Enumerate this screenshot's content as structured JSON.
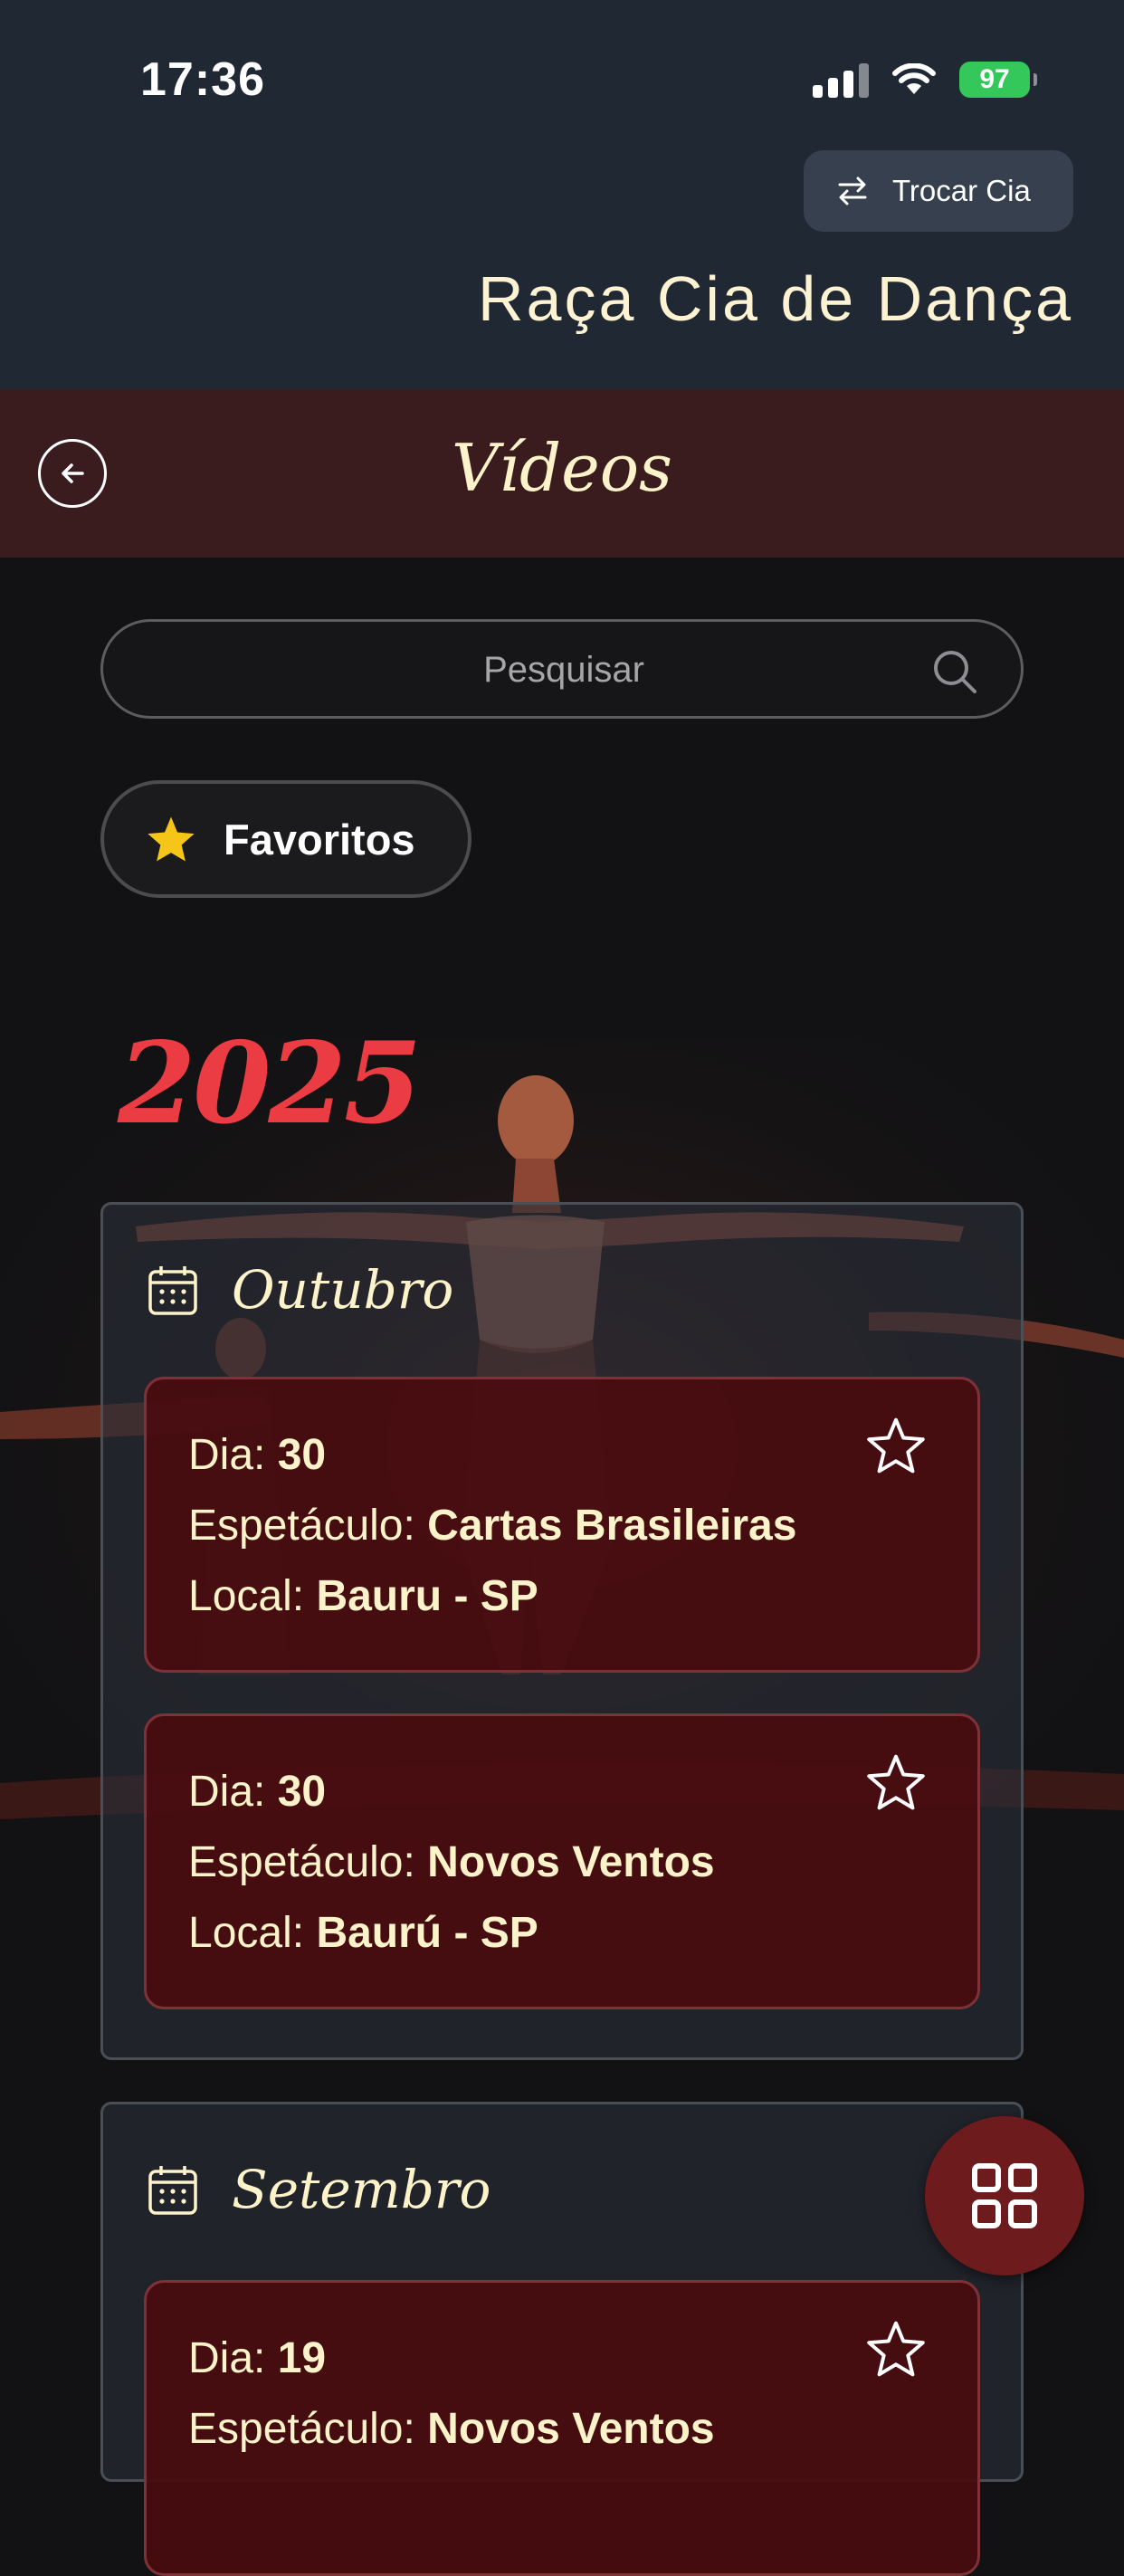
{
  "status_bar": {
    "time": "17:36",
    "battery": "97"
  },
  "header": {
    "switch_label": "Trocar Cia",
    "company_name": "Raça Cia de Dança",
    "title": "Vídeos"
  },
  "search": {
    "placeholder": "Pesquisar"
  },
  "favorites_label": "Favoritos",
  "year": "2025",
  "labels": {
    "day": "Dia:",
    "show": "Espetáculo:",
    "place": "Local:"
  },
  "months": [
    {
      "name": "Outubro",
      "events": [
        {
          "day": "30",
          "show": "Cartas Brasileiras",
          "place": "Bauru - SP"
        },
        {
          "day": "30",
          "show": "Novos Ventos",
          "place": "Baurú - SP"
        }
      ]
    },
    {
      "name": "Setembro",
      "events": [
        {
          "day": "19",
          "show": "Novos Ventos",
          "place": ""
        }
      ]
    }
  ],
  "colors": {
    "header_bg": "#202834",
    "title_bar_bg": "#3a1c1f",
    "accent_cream": "#fdf3cb",
    "year_red": "#ec3c43",
    "card_bg": "#490c0f",
    "fab_bg": "#6e1b1e",
    "star_yellow": "#f5c518"
  },
  "icons": [
    "swap-icon",
    "back-arrow-icon",
    "search-icon",
    "star-filled-icon",
    "calendar-icon",
    "star-outline-icon",
    "grid-icon"
  ]
}
